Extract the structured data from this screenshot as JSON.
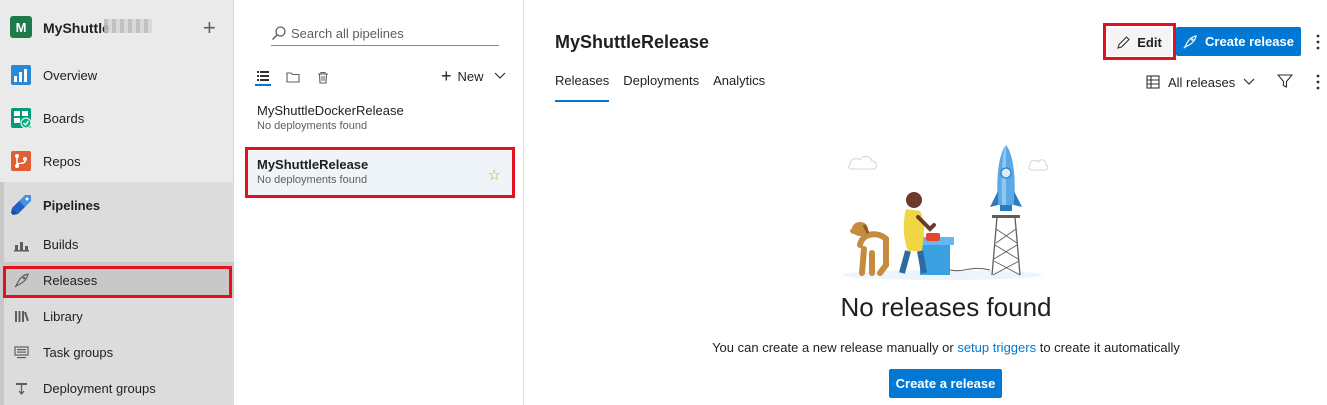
{
  "org": {
    "avatar_letter": "M",
    "name": "MyShuttle"
  },
  "nav": {
    "items": [
      {
        "label": "Overview",
        "icon": "overview-icon"
      },
      {
        "label": "Boards",
        "icon": "boards-icon"
      },
      {
        "label": "Repos",
        "icon": "repos-icon"
      },
      {
        "label": "Pipelines",
        "icon": "pipelines-icon"
      },
      {
        "label": "Builds",
        "icon": "builds-icon"
      },
      {
        "label": "Releases",
        "icon": "rocket-icon"
      },
      {
        "label": "Library",
        "icon": "library-icon"
      },
      {
        "label": "Task groups",
        "icon": "task-groups-icon"
      },
      {
        "label": "Deployment groups",
        "icon": "deployment-groups-icon"
      }
    ],
    "selected": "Releases"
  },
  "pipeline_list": {
    "search_placeholder": "Search all pipelines",
    "new_label": "New",
    "items": [
      {
        "name": "MyShuttleDockerRelease",
        "status": "No deployments found"
      },
      {
        "name": "MyShuttleRelease",
        "status": "No deployments found",
        "favorited": true
      }
    ]
  },
  "main": {
    "title": "MyShuttleRelease",
    "edit_label": "Edit",
    "create_release_label": "Create release",
    "tabs": [
      "Releases",
      "Deployments",
      "Analytics"
    ],
    "active_tab": "Releases",
    "filter_label": "All releases",
    "empty_title": "No releases found",
    "empty_desc_before": "You can create a new release manually or",
    "empty_desc_link": "setup triggers",
    "empty_desc_after": "to create it automatically",
    "create_button": "Create a release"
  },
  "colors": {
    "accent": "#0078d4",
    "highlight_box": "#e3101e",
    "star": "#d9a035"
  }
}
